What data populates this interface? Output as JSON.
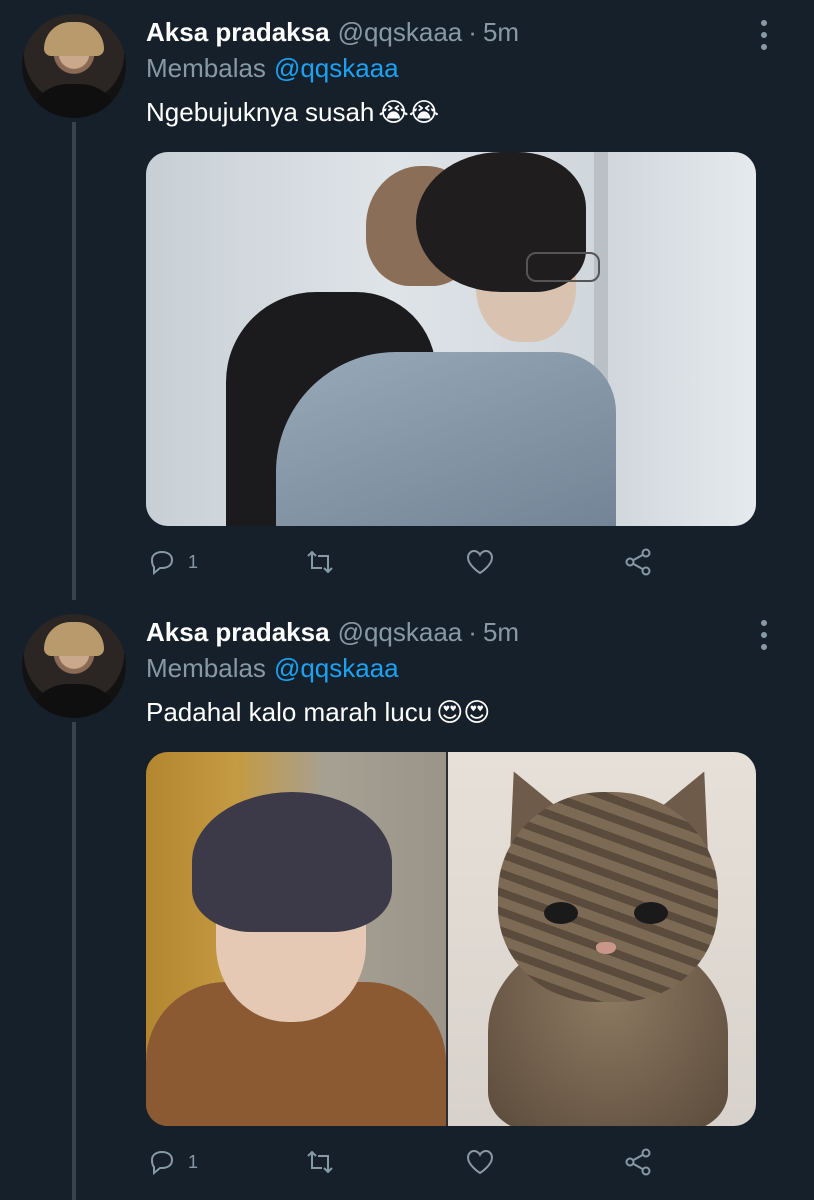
{
  "tweets": [
    {
      "author_name": "Aksa pradaksa",
      "handle": "@qqskaaa",
      "separator": "·",
      "time": "5m",
      "reply_prefix": "Membalas",
      "reply_to": "@qqskaaa",
      "text": "Ngebujuknya susah",
      "emojis": "😭😭",
      "reply_count": "1"
    },
    {
      "author_name": "Aksa pradaksa",
      "handle": "@qqskaaa",
      "separator": "·",
      "time": "5m",
      "reply_prefix": "Membalas",
      "reply_to": "@qqskaaa",
      "text": "Padahal kalo marah lucu",
      "emojis": "😍😍",
      "reply_count": "1"
    }
  ],
  "icons": {
    "reply": "reply-icon",
    "retweet": "retweet-icon",
    "like": "heart-icon",
    "share": "share-icon",
    "more": "more-vertical-icon"
  },
  "colors": {
    "background": "#15202b",
    "secondary_text": "#8899a6",
    "link": "#1da1f2"
  }
}
